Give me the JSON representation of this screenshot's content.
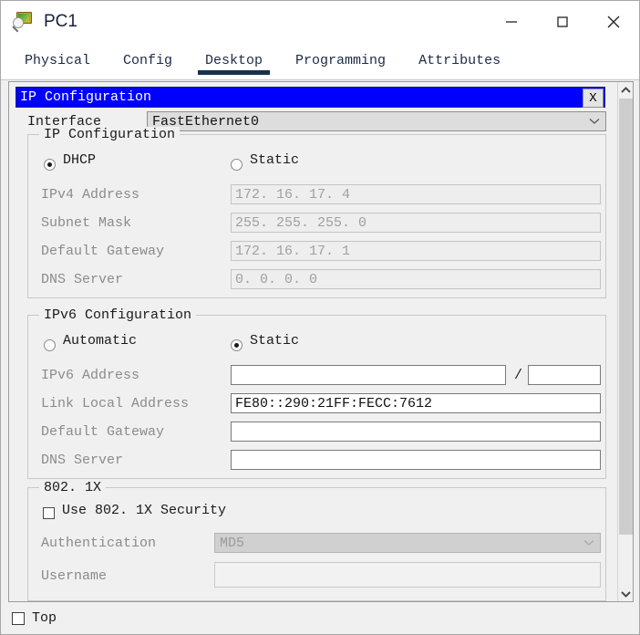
{
  "window": {
    "title": "PC1",
    "icon": "pc-magnifier-icon",
    "minimize_label": "—",
    "maximize_label": "☐",
    "close_label": "✕"
  },
  "tabs": [
    {
      "label": "Physical",
      "active": false
    },
    {
      "label": "Config",
      "active": false
    },
    {
      "label": "Desktop",
      "active": true
    },
    {
      "label": "Programming",
      "active": false
    },
    {
      "label": "Attributes",
      "active": false
    }
  ],
  "dialog": {
    "title": "IP Configuration",
    "close_label": "X",
    "title_bg": "#0000ff",
    "title_fg": "#ffffff"
  },
  "interface": {
    "label": "Interface",
    "value": "FastEthernet0"
  },
  "ip_config": {
    "group_title": "IP Configuration",
    "mode": "dhcp",
    "dhcp_label": "DHCP",
    "static_label": "Static",
    "fields": [
      {
        "label": "IPv4 Address",
        "value": "172. 16. 17. 4",
        "disabled": true
      },
      {
        "label": "Subnet Mask",
        "value": "255. 255. 255. 0",
        "disabled": true
      },
      {
        "label": "Default Gateway",
        "value": "172. 16. 17. 1",
        "disabled": true
      },
      {
        "label": "DNS Server",
        "value": "0. 0. 0. 0",
        "disabled": true
      }
    ]
  },
  "ipv6_config": {
    "group_title": "IPv6 Configuration",
    "mode": "static",
    "automatic_label": "Automatic",
    "static_label": "Static",
    "address_label": "IPv6 Address",
    "address_value": "",
    "prefix_separator": "/",
    "prefix_value": "",
    "link_local_label": "Link Local Address",
    "link_local_value": "FE80::290:21FF:FECC:7612",
    "gateway_label": "Default Gateway",
    "gateway_value": "",
    "dns_label": "DNS Server",
    "dns_value": ""
  },
  "dot1x": {
    "group_title": "802. 1X",
    "use_security_label": "Use 802. 1X Security",
    "use_security_checked": false,
    "authentication_label": "Authentication",
    "authentication_value": "MD5",
    "username_label": "Username",
    "username_value": ""
  },
  "bottom": {
    "top_label": "Top",
    "top_checked": false
  },
  "scrollbar": {
    "up_arrow": "⌃",
    "down_arrow": "⌄"
  }
}
